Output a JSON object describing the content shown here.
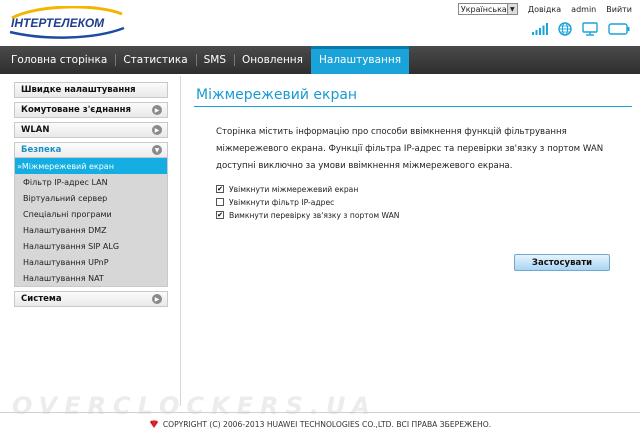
{
  "header": {
    "logo_text": "ІНТЕРТЕЛЕКОМ",
    "language": "Українська",
    "help": "Довідка",
    "user": "admin",
    "logout": "Вийти",
    "icons": [
      "signal-icon",
      "globe-icon",
      "monitor-icon",
      "battery-icon"
    ]
  },
  "nav": {
    "items": [
      {
        "label": "Головна сторінка"
      },
      {
        "label": "Статистика"
      },
      {
        "label": "SMS"
      },
      {
        "label": "Оновлення"
      },
      {
        "label": "Налаштування"
      }
    ],
    "active_index": 4
  },
  "sidebar": {
    "groups": [
      {
        "label": "Швидке налаштування"
      },
      {
        "label": "Комутоване з'єднання"
      },
      {
        "label": "WLAN"
      },
      {
        "label": "Безпека"
      },
      {
        "label": "Система"
      }
    ],
    "security_items": [
      {
        "label": "»Міжмережевий екран"
      },
      {
        "label": "Фільтр IP-адрес LAN"
      },
      {
        "label": "Віртуальний сервер"
      },
      {
        "label": "Спеціальні програми"
      },
      {
        "label": "Налаштування DMZ"
      },
      {
        "label": "Налаштування SIP ALG"
      },
      {
        "label": "Налаштування UPnP"
      },
      {
        "label": "Налаштування NAT"
      }
    ]
  },
  "main": {
    "title": "Міжмережевий екран",
    "description": "Сторінка містить інформацію про способи ввімкнення функцій фільтрування міжмережевого екрана. Функції фільтра IP-адрес та перевірки зв'язку з портом WAN доступні виключно за умови ввімкнення міжмережевого екрана.",
    "options": [
      {
        "label": "Увімкнути міжмережевий екран",
        "checked": true
      },
      {
        "label": "Увімкнути фільтр IP-адрес",
        "checked": false
      },
      {
        "label": "Вимкнути перевірку зв'язку з портом WAN",
        "checked": true
      }
    ],
    "apply_label": "Застосувати"
  },
  "footer": {
    "copyright": "COPYRIGHT (C) 2006-2013 HUAWEI TECHNOLOGIES CO.,LTD. ВСІ ПРАВА ЗБЕРЕЖЕНО.",
    "watermark": "OVERCLOCKERS.UA"
  },
  "colors": {
    "accent": "#1aa3d8",
    "nav_bg": "#3a3a3a"
  }
}
